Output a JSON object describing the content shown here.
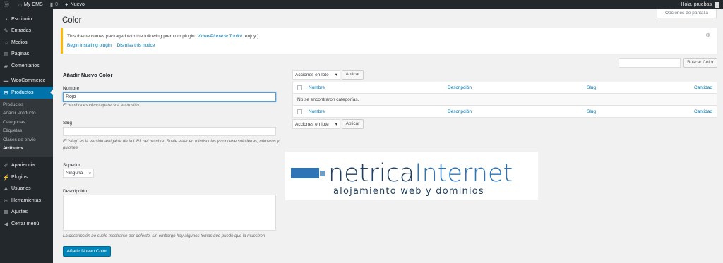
{
  "adminbar": {
    "site_name": "My CMS",
    "comments_count": "0",
    "new_label": "Nuevo",
    "greeting": "Hola, pruebas"
  },
  "screen_options": "Opciones de pantalla",
  "sidebar": {
    "items_top": [
      {
        "icon": "dashboard-icon",
        "glyph": "◔",
        "label": "Escritorio"
      },
      {
        "icon": "pin-icon",
        "glyph": "✎",
        "label": "Entradas"
      },
      {
        "icon": "media-icon",
        "glyph": "♫",
        "label": "Medios"
      },
      {
        "icon": "page-icon",
        "glyph": "▤",
        "label": "Páginas"
      },
      {
        "icon": "comments-icon",
        "glyph": "▰",
        "label": "Comentarios"
      }
    ],
    "woocommerce": {
      "icon": "woocommerce-icon",
      "glyph": "▬",
      "label": "WooCommerce"
    },
    "products": {
      "icon": "cart-icon",
      "glyph": "⊞",
      "label": "Productos"
    },
    "submenu": [
      "Productos",
      "Añadir Producto",
      "Categorías",
      "Etiquetas",
      "Clases de envío",
      "Atributos"
    ],
    "items_bottom": [
      {
        "icon": "appearance-icon",
        "glyph": "✐",
        "label": "Apariencia"
      },
      {
        "icon": "plugins-icon",
        "glyph": "⚡",
        "label": "Plugins"
      },
      {
        "icon": "users-icon",
        "glyph": "♟",
        "label": "Usuarios"
      },
      {
        "icon": "tools-icon",
        "glyph": "✂",
        "label": "Herramientas"
      },
      {
        "icon": "settings-icon",
        "glyph": "▦",
        "label": "Ajustes"
      },
      {
        "icon": "collapse-icon",
        "glyph": "◀",
        "label": "Cerrar menú"
      }
    ]
  },
  "page_title": "Color",
  "notice": {
    "text_before": "This theme comes packaged with the following premium plugin: ",
    "plugin_name": "Virtue/Pinnacle Toolkit",
    "text_after": ". enjoy:)",
    "install_link": "Begin installing plugin",
    "separator": "|",
    "dismiss_link": "Dismiss this notice"
  },
  "search_button": "Buscar Color",
  "form": {
    "title": "Añadir Nuevo Color",
    "name_label": "Nombre",
    "name_value": "Rojo",
    "name_desc": "El nombre es cómo aparecerá en tu sitio.",
    "slug_label": "Slug",
    "slug_desc_1": "El “slug” es la versión amigable de la URL del nombre. Suele estar en minúsculas y contiene sólo letras, números y",
    "slug_desc_2": "guiones.",
    "parent_label": "Superior",
    "parent_value": "Ninguna",
    "description_label": "Descripción",
    "description_desc": "La descripción no suele mostrarse por defecto, sin embargo hay algunos temas que puede que la muestren.",
    "submit": "Añadir Nuevo Color"
  },
  "table": {
    "bulk_label": "Acciones en lote",
    "apply_label": "Aplicar",
    "columns": [
      "Nombre",
      "Descripción",
      "Slug",
      "Cantidad"
    ],
    "empty_message": "No se encontraron categorías."
  },
  "logo": {
    "text_main": "netrica",
    "text_accent": "Internet",
    "tagline": "alojamiento web y dominios",
    "color_blue": "#2e75b6",
    "color_dark": "#1f3f60"
  }
}
